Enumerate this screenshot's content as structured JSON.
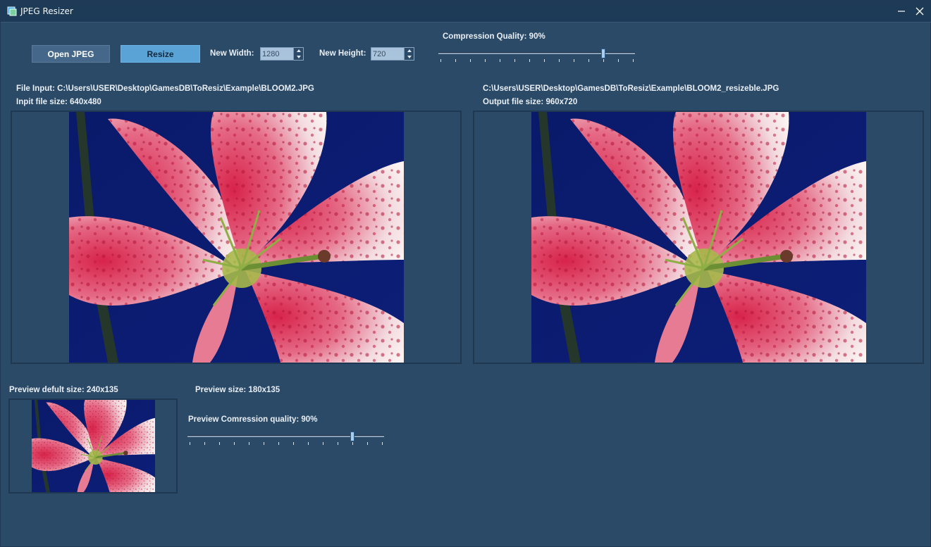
{
  "window": {
    "title": "JPEG Resizer"
  },
  "toolbar": {
    "open_label": "Open JPEG",
    "resize_label": "Resize",
    "width_label": "New Width:",
    "width_value": "1280",
    "height_label": "New Height:",
    "height_value": "720",
    "quality_label": "Compression Quality: 90%",
    "quality_value": 0.84
  },
  "input": {
    "path_label": "File Input: C:\\Users\\USER\\Desktop\\GamesDB\\ToResiz\\Example\\BLOOM2.JPG",
    "size_label": "Inpit file size: 640x480"
  },
  "output": {
    "path_label": "C:\\Users\\USER\\Desktop\\GamesDB\\ToResiz\\Example\\BLOOM2_resizeble.JPG",
    "size_label": "Output file size: 960x720"
  },
  "preview": {
    "default_size_label": "Preview defult size: 240x135",
    "size_label": "Preview size: 180x135",
    "quality_label": "Preview Comression quality: 90%",
    "quality_value": 0.84
  },
  "colors": {
    "background": "#2b4a68",
    "titlebar": "#1d3a56",
    "accent": "#5aa3d6"
  }
}
